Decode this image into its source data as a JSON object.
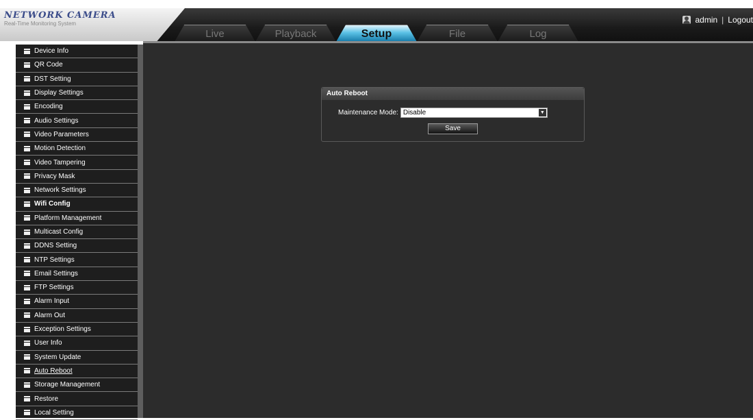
{
  "app": {
    "title": "NETWORK CAMERA",
    "subtitle": "Real-Time Monitoring System"
  },
  "tabs": [
    {
      "label": "Live",
      "active": false
    },
    {
      "label": "Playback",
      "active": false
    },
    {
      "label": "Setup",
      "active": true
    },
    {
      "label": "File",
      "active": false
    },
    {
      "label": "Log",
      "active": false
    }
  ],
  "user": {
    "name": "admin",
    "separator": "|",
    "logout": "Logout"
  },
  "sidebar": {
    "items": [
      {
        "label": "Device Info"
      },
      {
        "label": "QR Code"
      },
      {
        "label": "DST Setting"
      },
      {
        "label": "Display Settings"
      },
      {
        "label": "Encoding"
      },
      {
        "label": "Audio Settings"
      },
      {
        "label": "Video Parameters"
      },
      {
        "label": "Motion Detection"
      },
      {
        "label": "Video Tampering"
      },
      {
        "label": "Privacy Mask"
      },
      {
        "label": "Network Settings"
      },
      {
        "label": "Wifi Config"
      },
      {
        "label": "Platform Management"
      },
      {
        "label": "Multicast Config"
      },
      {
        "label": "DDNS Setting"
      },
      {
        "label": "NTP Settings"
      },
      {
        "label": "Email Settings"
      },
      {
        "label": "FTP Settings"
      },
      {
        "label": "Alarm Input"
      },
      {
        "label": "Alarm Out"
      },
      {
        "label": "Exception Settings"
      },
      {
        "label": "User Info"
      },
      {
        "label": "System Update"
      },
      {
        "label": "Auto Reboot"
      },
      {
        "label": "Storage Management"
      },
      {
        "label": "Restore"
      },
      {
        "label": "Local Setting"
      }
    ],
    "selected": "Auto Reboot"
  },
  "panel": {
    "title": "Auto Reboot",
    "maintenance_label": "Maintenance Mode:",
    "maintenance_value": "Disable",
    "save_label": "Save"
  },
  "colors": {
    "accent_tab": "#5ac1e5",
    "background": "#2c2c2c",
    "sidebar": "#1e1e1e"
  }
}
